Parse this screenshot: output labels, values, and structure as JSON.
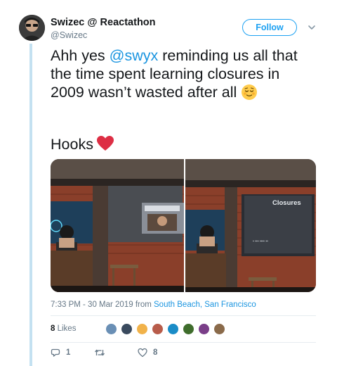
{
  "author": {
    "display_name": "Swizec @ Reactathon",
    "handle": "@Swizec"
  },
  "follow_label": "Follow",
  "tweet": {
    "text_before": "Ahh yes ",
    "mention": "@swyx",
    "text_after": " reminding us all that the time spent learning closures in 2009 wasn’t wasted after all ",
    "hooks_line": "Hooks"
  },
  "media": {
    "slide_title": "Closures"
  },
  "meta": {
    "time": "7:33 PM - 30 Mar 2019",
    "from_label": " from ",
    "place": "South Beach, San Francisco"
  },
  "likes": {
    "count": "8",
    "label": " Likes"
  },
  "actions": {
    "reply_count": "1",
    "retweet_count": "",
    "like_count": "8"
  },
  "icons": [
    "chevron-down-icon",
    "reply-icon",
    "retweet-icon",
    "heart-icon",
    "relieved-face-emoji",
    "red-heart-emoji"
  ],
  "colors": {
    "accent": "#1da1f2",
    "link": "#1b95e0",
    "thread_line": "#c4e1f1",
    "muted": "#657786"
  }
}
